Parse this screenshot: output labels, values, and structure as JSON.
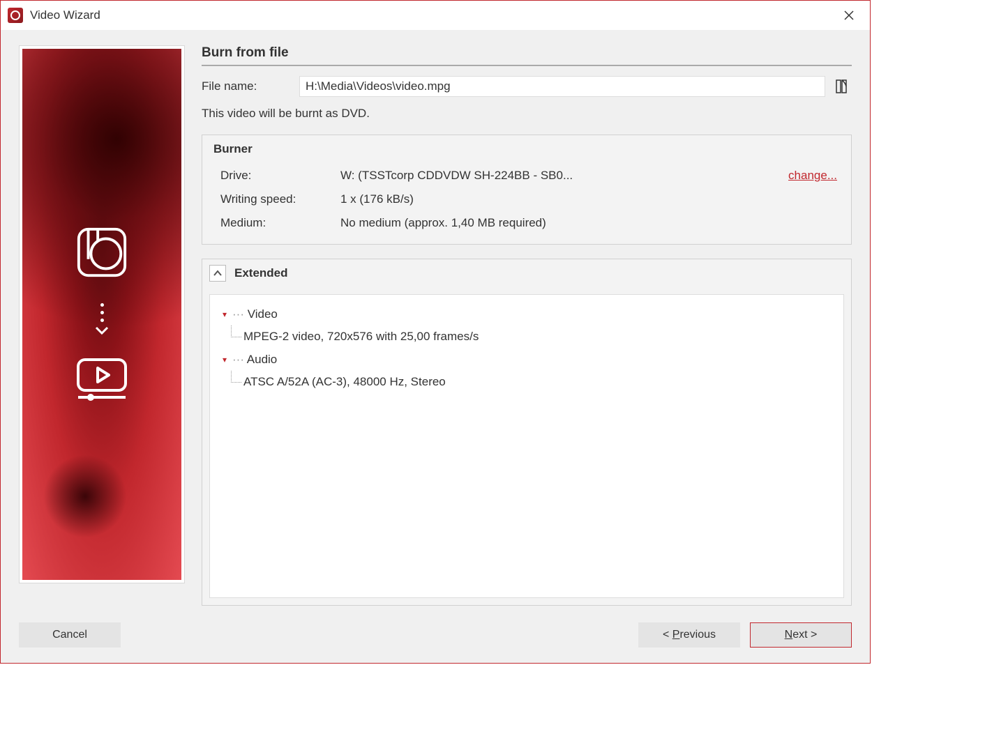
{
  "window": {
    "title": "Video Wizard"
  },
  "section_title": "Burn from file",
  "file": {
    "label": "File name:",
    "path": "H:\\Media\\Videos\\video.mpg"
  },
  "info_line": "This video will be burnt as DVD.",
  "burner": {
    "title": "Burner",
    "drive_label": "Drive:",
    "drive_value": "W: (TSSTcorp CDDVDW SH-224BB - SB0...",
    "change": "change...",
    "speed_label": "Writing speed:",
    "speed_value": "1 x (176 kB/s)",
    "medium_label": "Medium:",
    "medium_value": "No medium (approx. 1,40 MB required)"
  },
  "extended": {
    "title": "Extended",
    "video_label": "Video",
    "video_detail": "MPEG-2 video, 720x576 with 25,00 frames/s",
    "audio_label": "Audio",
    "audio_detail": "ATSC A/52A (AC-3), 48000 Hz, Stereo"
  },
  "buttons": {
    "cancel": "Cancel",
    "previous_prefix": "< ",
    "previous_u": "P",
    "previous_rest": "revious",
    "next_u": "N",
    "next_rest": "ext >"
  }
}
